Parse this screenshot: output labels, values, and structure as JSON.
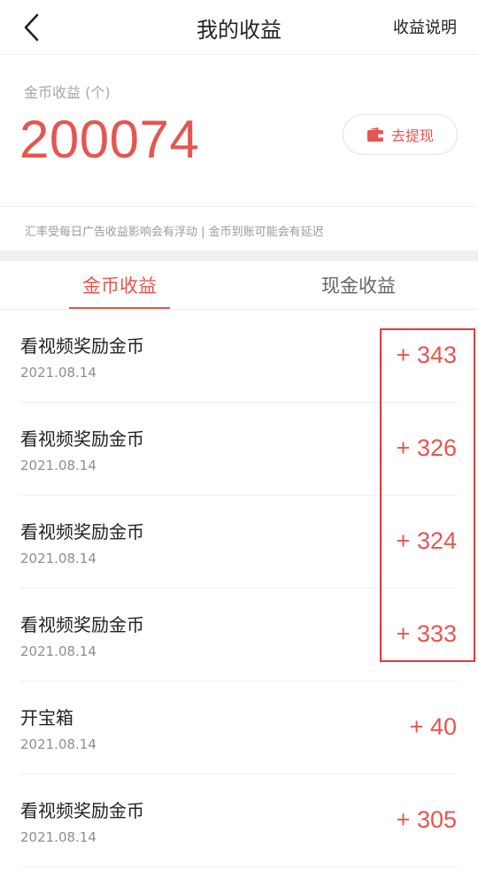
{
  "header": {
    "title": "我的收益",
    "help_link": "收益说明",
    "back_icon": "chevron-left-icon"
  },
  "summary": {
    "label": "金币收益 (个)",
    "total": "200074",
    "withdraw_label": "去提现",
    "withdraw_icon": "wallet-icon"
  },
  "notice": "汇率受每日广告收益影响会有浮动 | 金币到账可能会有延迟",
  "tabs": [
    {
      "label": "金币收益",
      "active": true
    },
    {
      "label": "现金收益",
      "active": false
    }
  ],
  "records": [
    {
      "title": "看视频奖励金币",
      "date": "2021.08.14",
      "amount": "+ 343"
    },
    {
      "title": "看视频奖励金币",
      "date": "2021.08.14",
      "amount": "+ 326"
    },
    {
      "title": "看视频奖励金币",
      "date": "2021.08.14",
      "amount": "+ 324"
    },
    {
      "title": "看视频奖励金币",
      "date": "2021.08.14",
      "amount": "+ 333"
    },
    {
      "title": "开宝箱",
      "date": "2021.08.14",
      "amount": "+ 40"
    },
    {
      "title": "看视频奖励金币",
      "date": "2021.08.14",
      "amount": "+ 305"
    }
  ],
  "colors": {
    "accent": "#e4564f",
    "annotation_box": "#e03b3b"
  }
}
